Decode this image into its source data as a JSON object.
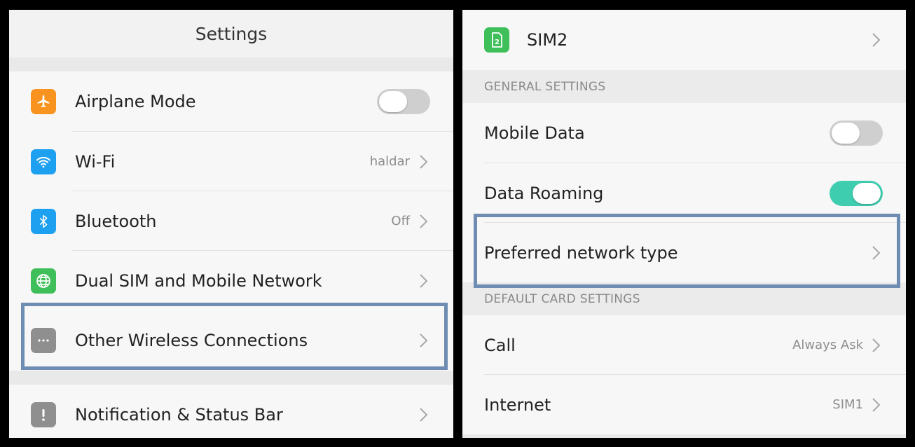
{
  "left_panel": {
    "title": "Settings",
    "items": [
      {
        "label": "Airplane Mode",
        "icon": "airplane-icon",
        "icon_color": "#f7931e",
        "toggle": "off"
      },
      {
        "label": "Wi-Fi",
        "icon": "wifi-icon",
        "icon_color": "#1ea0f0",
        "value": "haldar"
      },
      {
        "label": "Bluetooth",
        "icon": "bluetooth-icon",
        "icon_color": "#1ea0f0",
        "value": "Off"
      },
      {
        "label": "Dual SIM and Mobile Network",
        "icon": "globe-icon",
        "icon_color": "#3fbf5a"
      },
      {
        "label": "Other Wireless Connections",
        "icon": "more-dots-icon",
        "icon_color": "#8f8f8f"
      },
      {
        "label": "Notification & Status Bar",
        "icon": "exclamation-icon",
        "icon_color": "#8f8f8f"
      }
    ]
  },
  "right_panel": {
    "sim2": {
      "label": "SIM2",
      "icon": "sim-card-icon",
      "icon_color": "#3fbf5a",
      "icon_text": "2"
    },
    "general_settings": {
      "header": "GENERAL SETTINGS",
      "mobile_data": {
        "label": "Mobile Data",
        "toggle": "off"
      },
      "data_roaming": {
        "label": "Data Roaming",
        "toggle": "on"
      },
      "preferred_network": {
        "label": "Preferred network type"
      }
    },
    "default_card_settings": {
      "header": "DEFAULT CARD SETTINGS",
      "call": {
        "label": "Call",
        "value": "Always Ask"
      },
      "internet": {
        "label": "Internet",
        "value": "SIM1"
      }
    }
  },
  "colors": {
    "toggle_on": "#3fcdb0",
    "toggle_off": "#cfcfcf",
    "highlight_border": "#6f8db2"
  }
}
